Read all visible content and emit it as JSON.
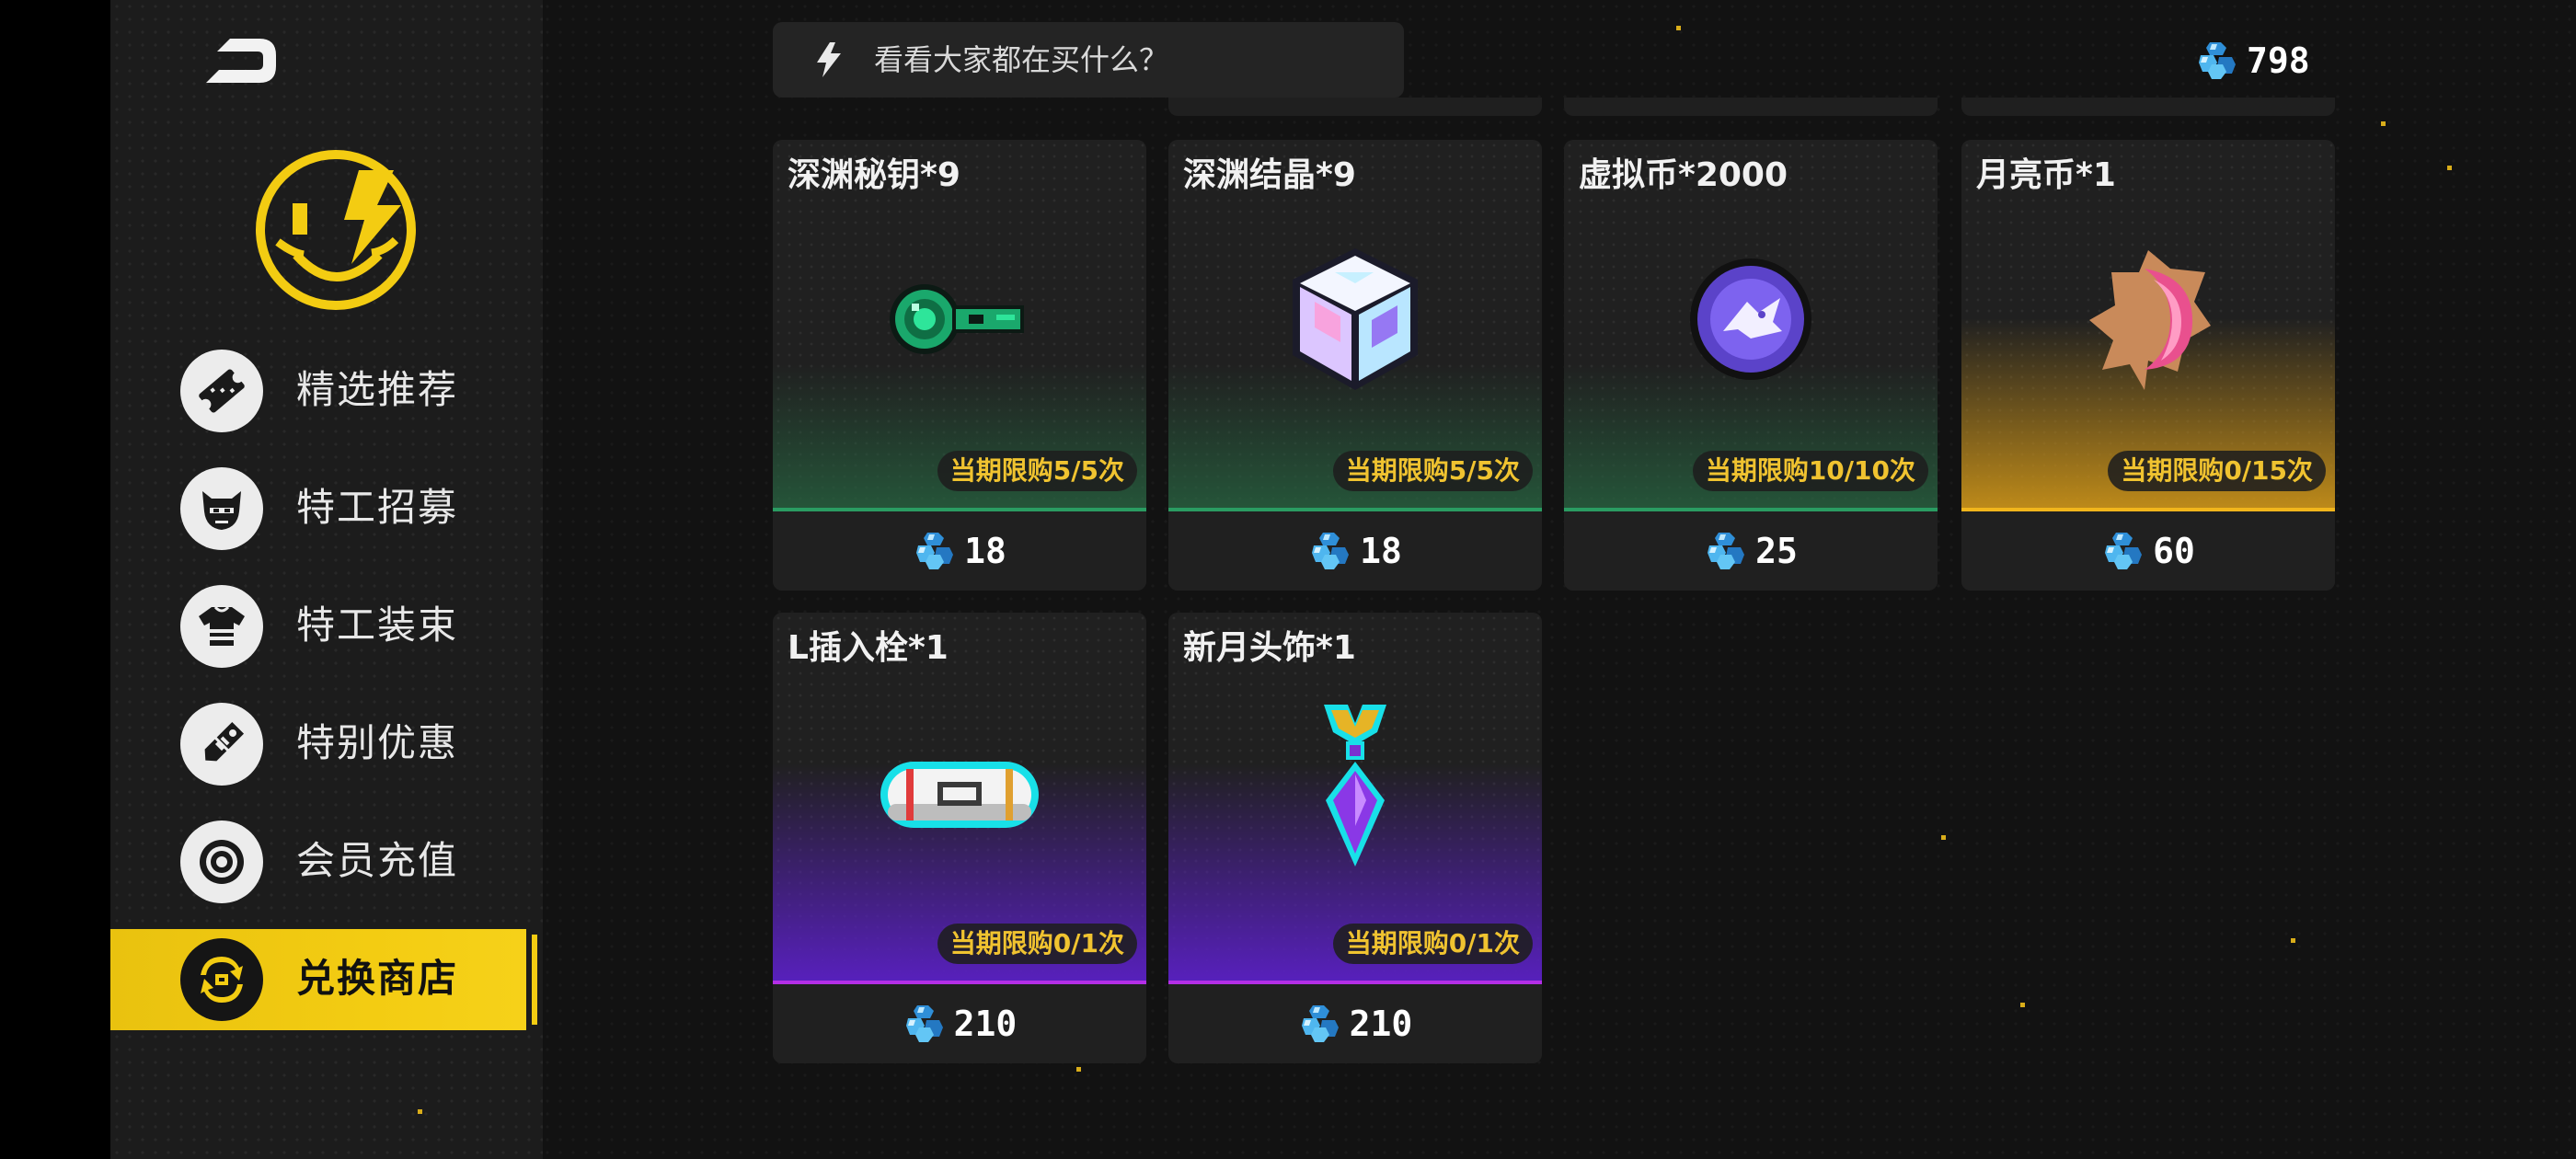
{
  "search": {
    "placeholder_text": "看看大家都在买什么？"
  },
  "balance": {
    "amount": "798"
  },
  "nav": {
    "items": [
      {
        "label": "精选推荐",
        "icon": "ticket-icon"
      },
      {
        "label": "特工招募",
        "icon": "agent-face-icon"
      },
      {
        "label": "特工装束",
        "icon": "shirt-icon"
      },
      {
        "label": "特别优惠",
        "icon": "tag-icon"
      },
      {
        "label": "会员充值",
        "icon": "coin-icon"
      },
      {
        "label": "兑换商店",
        "icon": "exchange-icon",
        "active": true
      }
    ]
  },
  "products": [
    {
      "name": "深渊秘钥*9",
      "limit": "当期限购5/5次",
      "price": "18",
      "image": "abyss-key-icon",
      "theme": "green"
    },
    {
      "name": "深渊结晶*9",
      "limit": "当期限购5/5次",
      "price": "18",
      "image": "abyss-crystal-icon",
      "theme": "green"
    },
    {
      "name": "虚拟币*2000",
      "limit": "当期限购10/10次",
      "price": "25",
      "image": "virtual-coin-icon",
      "theme": "green"
    },
    {
      "name": "月亮币*1",
      "limit": "当期限购0/15次",
      "price": "60",
      "image": "moon-coin-icon",
      "theme": "gold"
    },
    {
      "name": "L插入栓*1",
      "limit": "当期限购0/1次",
      "price": "210",
      "image": "plug-capsule-icon",
      "theme": "purple"
    },
    {
      "name": "新月头饰*1",
      "limit": "当期限购0/1次",
      "price": "210",
      "image": "crescent-headpiece-icon",
      "theme": "purple"
    }
  ],
  "colors": {
    "accent_yellow": "#f3cc12",
    "limit_text": "#f0c330",
    "gem_blue": "#3fa0e6",
    "green_line": "#2a9c62",
    "gold_line": "#f1b51c",
    "purple_line": "#b42ee6"
  }
}
